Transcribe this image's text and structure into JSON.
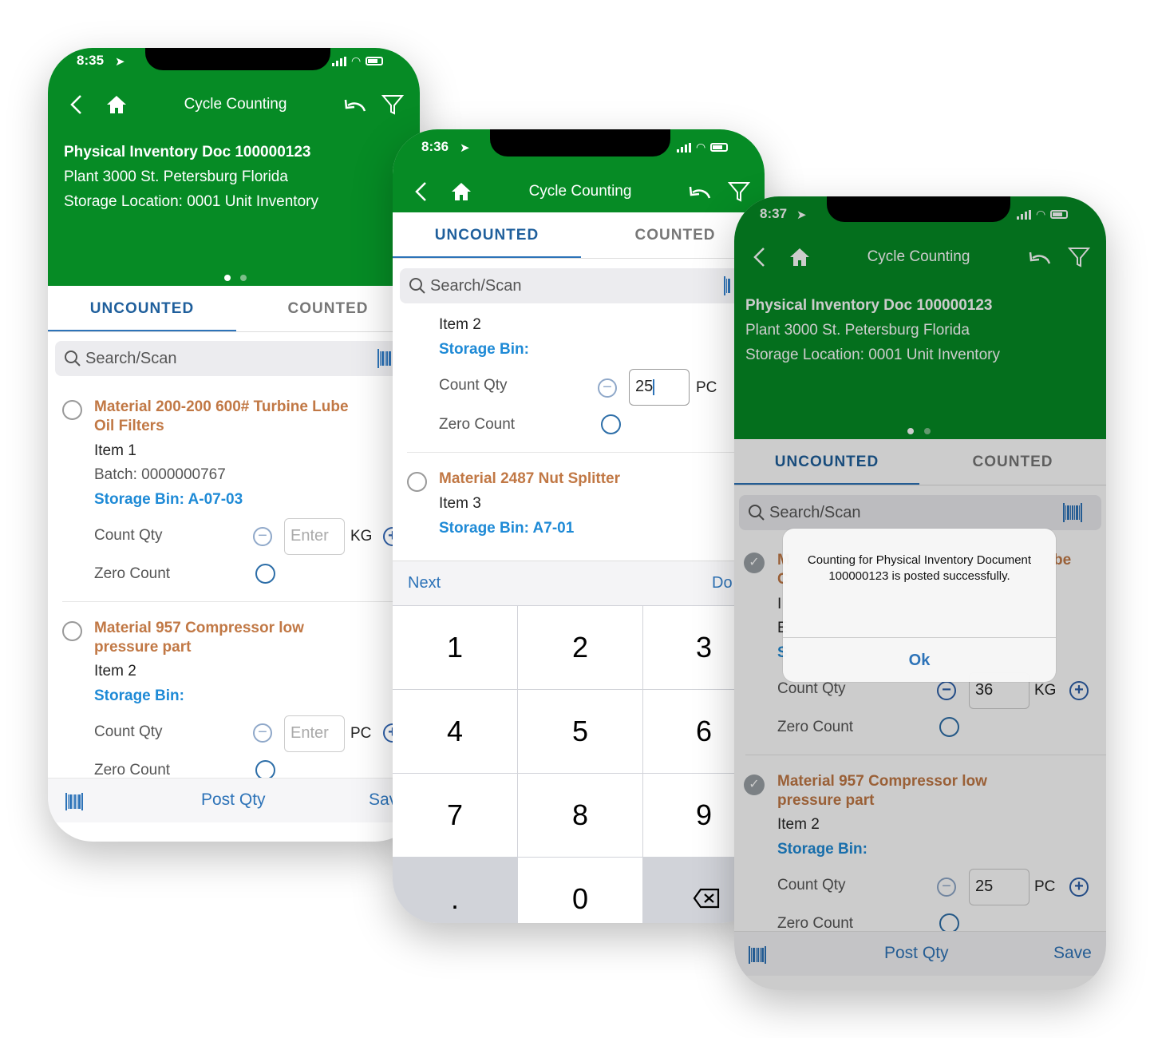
{
  "app_title": "Cycle Counting",
  "tabs": {
    "uncounted": "UNCOUNTED",
    "counted": "COUNTED"
  },
  "search_placeholder": "Search/Scan",
  "doc_header": {
    "doc": "Physical Inventory Doc 100000123",
    "plant": "Plant 3000 St. Petersburg Florida",
    "location": "Storage Location: 0001 Unit Inventory"
  },
  "footer": {
    "post": "Post Qty",
    "save": "Save",
    "save_clip": "Sav"
  },
  "colors": {
    "header_green": "#068b25",
    "accent_blue": "#2d73b8",
    "material_orange": "#c17845"
  },
  "phone1": {
    "time": "8:35",
    "items": [
      {
        "material_l1": "Material 200-200 600# Turbine Lube",
        "material_l2": "Oil Filters",
        "item": "Item 1",
        "batch": "Batch: 0000000767",
        "bin": "Storage Bin: A-07-03",
        "count_label": "Count Qty",
        "placeholder": "Enter",
        "unit": "KG",
        "zero_label": "Zero Count"
      },
      {
        "material_l1": "Material 957 Compressor low",
        "material_l2": "pressure part",
        "item": "Item 2",
        "bin": "Storage Bin:",
        "count_label": "Count Qty",
        "placeholder": "Enter",
        "unit": "PC",
        "zero_label": "Zero Count"
      }
    ]
  },
  "phone2": {
    "time": "8:36",
    "item_a": {
      "item": "Item 2",
      "bin": "Storage Bin:",
      "count_label": "Count Qty",
      "value": "25",
      "unit": "PC",
      "zero_label": "Zero Count"
    },
    "item_b": {
      "material": "Material 2487 Nut Splitter",
      "item": "Item 3",
      "bin": "Storage Bin: A7-01"
    },
    "kb_next": "Next",
    "kb_done": "Do",
    "keys": [
      "1",
      "2",
      "3",
      "4",
      "5",
      "6",
      "7",
      "8",
      "9",
      ".",
      "0"
    ]
  },
  "phone3": {
    "time": "8:37",
    "dialog_msg": "Counting for Physical Inventory Document 100000123 is posted successfully.",
    "dialog_ok": "Ok",
    "item_a": {
      "count_label": "Count Qty",
      "value": "36",
      "unit": "KG",
      "zero_label": "Zero Count",
      "frag_m": "M",
      "frag_c": "C",
      "frag_i": "I",
      "frag_e": "E",
      "frag_s": "S",
      "frag_be": "be"
    },
    "item_b": {
      "material_l1": "Material 957 Compressor low",
      "material_l2": "pressure part",
      "item": "Item 2",
      "bin": "Storage Bin:",
      "count_label": "Count Qty",
      "value": "25",
      "unit": "PC",
      "zero_label": "Zero Count"
    }
  }
}
